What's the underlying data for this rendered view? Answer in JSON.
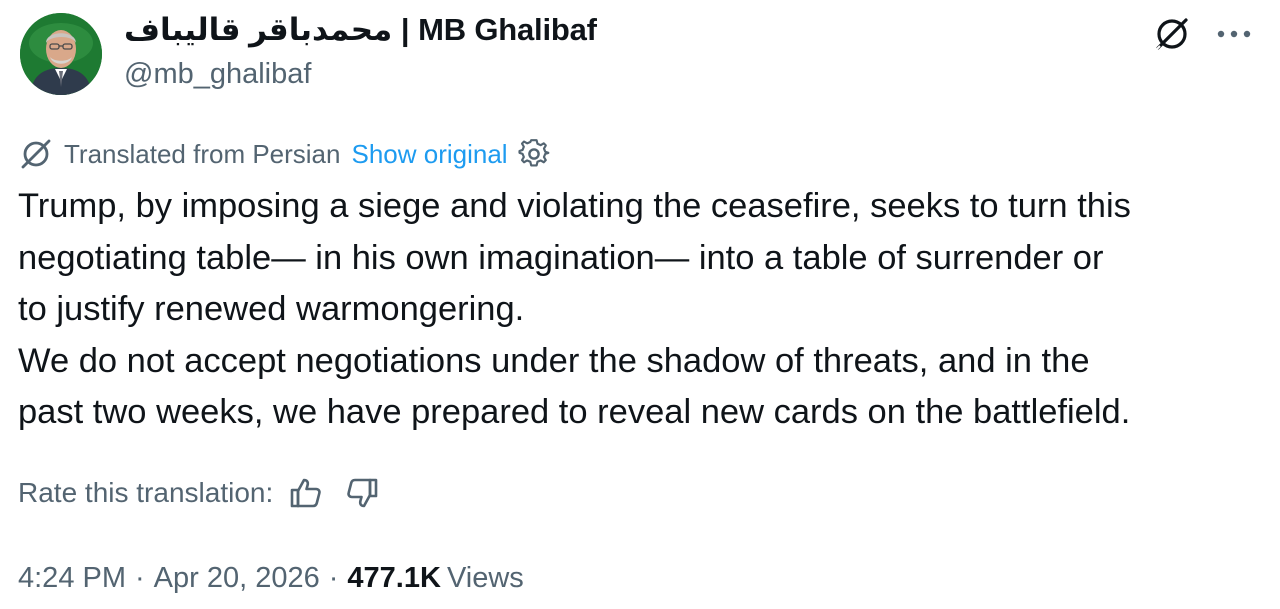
{
  "author": {
    "display_name": "محمدباقر قالیباف | MB Ghalibaf",
    "handle": "@mb_ghalibaf"
  },
  "translation": {
    "label": "Translated from Persian",
    "show_original": "Show original"
  },
  "tweet": {
    "lines": [
      "Trump, by imposing a siege and violating the ceasefire, seeks to turn this",
      "negotiating table— in his own imagination— into a table of surrender or",
      "to justify renewed warmongering.",
      "We do not accept negotiations under the shadow of threats, and in the",
      "past two weeks, we have prepared to reveal new cards on the battlefield."
    ]
  },
  "rating": {
    "label": "Rate this translation:"
  },
  "meta": {
    "time": "4:24 PM",
    "separator": "·",
    "date": "Apr 20, 2026",
    "views_count": "477.1K",
    "views_label": "Views"
  },
  "icons": {
    "avatar": "profile-photo",
    "grok": "grok-icon",
    "more": "more-icon",
    "translate": "grok-icon",
    "gear": "gear-icon",
    "like": "thumbs-up-icon",
    "dislike": "thumbs-down-icon"
  },
  "colors": {
    "text": "#0f1419",
    "secondary": "#536471",
    "link": "#1d9bf0",
    "avatar_bg": "#1e7a32"
  }
}
